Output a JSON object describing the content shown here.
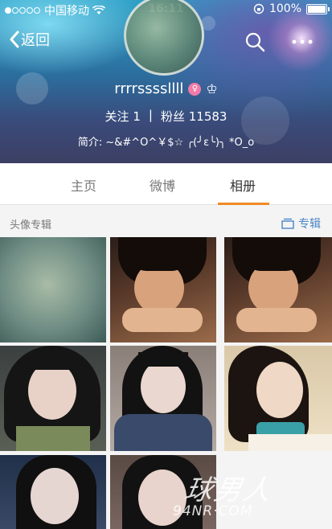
{
  "status_bar": {
    "carrier": "中国移动",
    "time": "16:11",
    "battery": "100%"
  },
  "header": {
    "back_label": "返回",
    "username": "rrrrssssllll",
    "following_label": "关注",
    "following_count": "1",
    "divider": "|",
    "followers_label": "粉丝",
    "followers_count": "11583",
    "bio": "简介: ~&#^O^￥$☆ ╭(╯ε╰)╮ *O_o"
  },
  "tabs": [
    {
      "label": "主页",
      "active": false
    },
    {
      "label": "微博",
      "active": false
    },
    {
      "label": "相册",
      "active": true
    }
  ],
  "album_section": {
    "title": "头像专辑",
    "link_label": "专辑"
  },
  "photos": [
    {
      "alt": "textured green background"
    },
    {
      "alt": "girl resting chin on hands"
    },
    {
      "alt": "girl resting chin on hands"
    },
    {
      "alt": "girl in uniform"
    },
    {
      "alt": "girl with scarf"
    },
    {
      "alt": "girl with hand on head"
    },
    {
      "alt": "girl selfie"
    },
    {
      "alt": "girl selfie"
    }
  ],
  "watermark": {
    "text": "球男人",
    "url": "94NR·COM"
  },
  "colors": {
    "accent": "#f08a24",
    "link": "#4a86c6"
  }
}
